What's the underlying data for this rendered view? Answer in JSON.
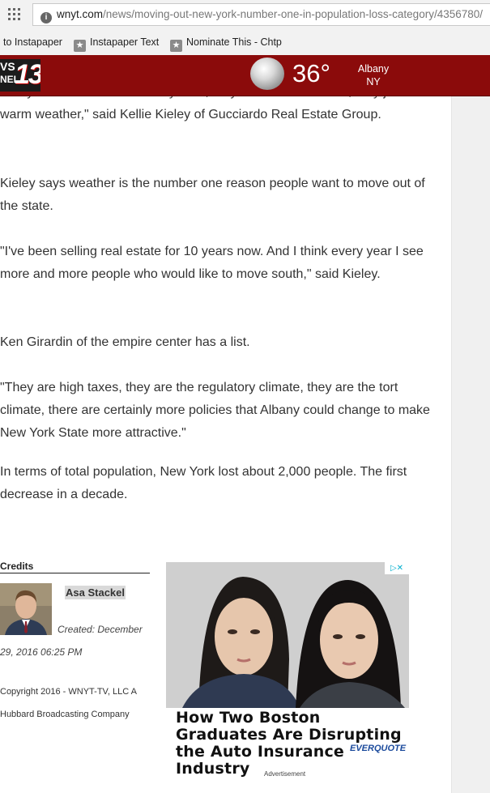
{
  "browser": {
    "url_host": "wnyt.com",
    "url_path": "/news/moving-out-new-york-number-one-in-population-loss-category/4356780/",
    "bookmarks": [
      "to Instapaper",
      "Instapaper Text",
      "Nominate This - Chtp"
    ]
  },
  "header": {
    "logo_top": "VS",
    "logo_bottom": "NEL",
    "logo_number": "13",
    "temperature": "36°",
    "location_city": "Albany",
    "location_state": "NY",
    "weather_icon": "cloud-icon",
    "header_color": "#8b0b0b"
  },
  "article": {
    "paragraphs": [
      "\"They don't want to shovel anymore, they don't want the cold, they just want warm weather,\" said Kellie Kieley of Gucciardo Real Estate Group.",
      "Kieley says weather is the number one reason people want to move out of the state.",
      "\"I've been selling real estate for 10 years now. And I think every year I see more and more people who would like to move south,\" said Kieley.",
      "Ken Girardin of the empire center has a list.",
      "\"They are high taxes, they are the regulatory climate, they are the tort climate, there are certainly more policies that Albany could change to make New York State more attractive.\"",
      "In terms of total population, New York lost about 2,000 people. The first decrease in a decade."
    ]
  },
  "credits": {
    "title": "Credits",
    "author": "Asa Stackel",
    "created_line1": "Created: December",
    "created_line2": "29, 2016 06:25 PM",
    "copyright_line1": "Copyright 2016 - WNYT-TV, LLC A",
    "copyright_line2": "Hubbard Broadcasting Company"
  },
  "ad": {
    "headline": "How Two Boston Graduates Are Disrupting the Auto Insurance Industry",
    "brand": "EVERQUOTE",
    "label": "Advertisement",
    "choices_icon": "adchoices-icon"
  }
}
